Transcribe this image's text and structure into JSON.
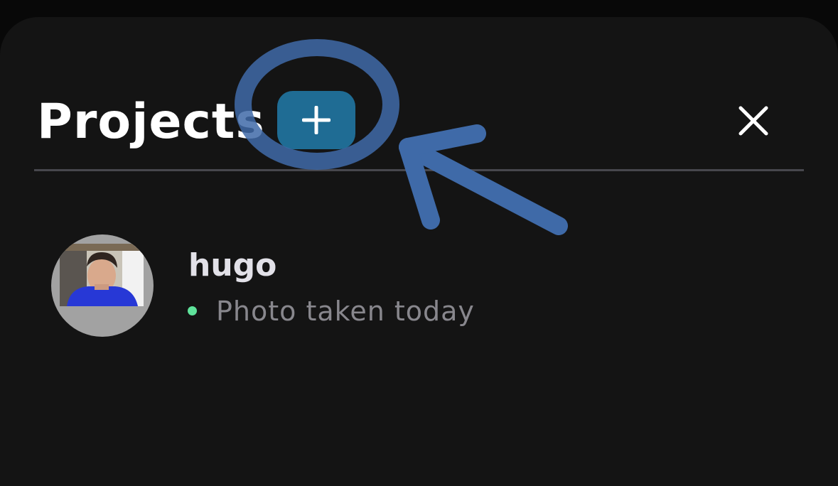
{
  "header": {
    "title": "Projects",
    "add_button_icon": "plus-icon",
    "close_button_icon": "close-icon"
  },
  "projects": [
    {
      "name": "hugo",
      "status": "Photo taken today",
      "status_color": "#5fe39b",
      "avatar": "avatar-photo"
    }
  ],
  "colors": {
    "background": "#141414",
    "accent": "#1f6c94",
    "annotation": "#3f6aa8",
    "divider": "#47474d"
  }
}
